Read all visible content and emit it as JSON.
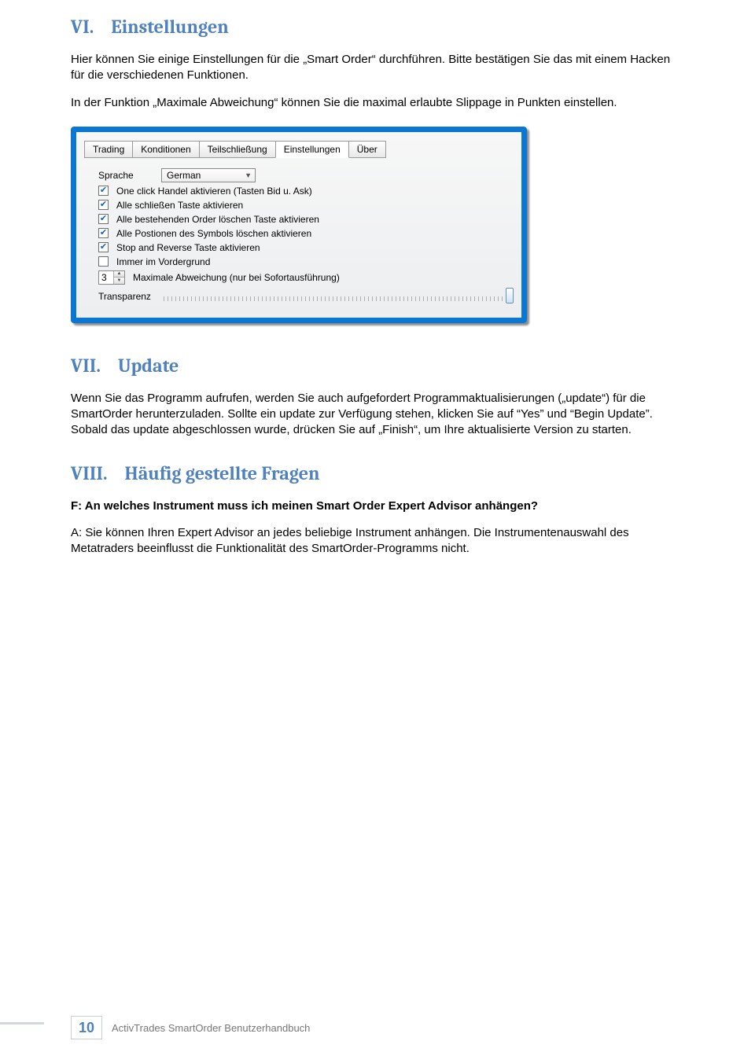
{
  "section6": {
    "num": "VI.",
    "title": "Einstellungen",
    "para1": "Hier können Sie einige Einstellungen für die „Smart Order“ durchführen. Bitte bestätigen Sie das mit einem Hacken für die verschiedenen Funktionen.",
    "para2": "In der Funktion „Maximale Abweichung“ können Sie die maximal erlaubte Slippage in Punkten einstellen."
  },
  "window": {
    "tabs": [
      "Trading",
      "Konditionen",
      "Teilschließung",
      "Einstellungen",
      "Über"
    ],
    "active_tab": "Einstellungen",
    "sprache_label": "Sprache",
    "sprache_value": "German",
    "checkboxes": [
      {
        "label": "One click Handel aktivieren (Tasten Bid u. Ask)",
        "checked": true
      },
      {
        "label": "Alle schließen Taste aktivieren",
        "checked": true
      },
      {
        "label": "Alle bestehenden Order löschen Taste aktivieren",
        "checked": true
      },
      {
        "label": "Alle Postionen des Symbols löschen aktivieren",
        "checked": true
      },
      {
        "label": "Stop and Reverse Taste aktivieren",
        "checked": true
      },
      {
        "label": "Immer im Vordergrund",
        "checked": false
      }
    ],
    "spin_value": "3",
    "spin_label": "Maximale Abweichung (nur bei Sofortausführung)",
    "transparency_label": "Transparenz"
  },
  "section7": {
    "num": "VII.",
    "title": "Update",
    "para": "Wenn Sie das Programm aufrufen, werden Sie auch aufgefordert Programmaktualisierungen („update“) für die SmartOrder herunterzuladen. Sollte ein update zur Verfügung stehen, klicken Sie auf “Yes” und “Begin Update”. Sobald das update abgeschlossen wurde, drücken Sie auf „Finish“, um Ihre aktualisierte Version zu starten."
  },
  "section8": {
    "num": "VIII.",
    "title": "Häufig gestellte Fragen",
    "q": "F: An welches Instrument muss ich meinen Smart Order Expert Advisor anhängen?",
    "a": "A: Sie können Ihren Expert Advisor an jedes beliebige Instrument anhängen. Die Instrumentenauswahl des Metatraders beeinflusst die Funktionalität des SmartOrder-Programms nicht."
  },
  "footer": {
    "page": "10",
    "text": "ActivTrades SmartOrder Benutzerhandbuch"
  }
}
